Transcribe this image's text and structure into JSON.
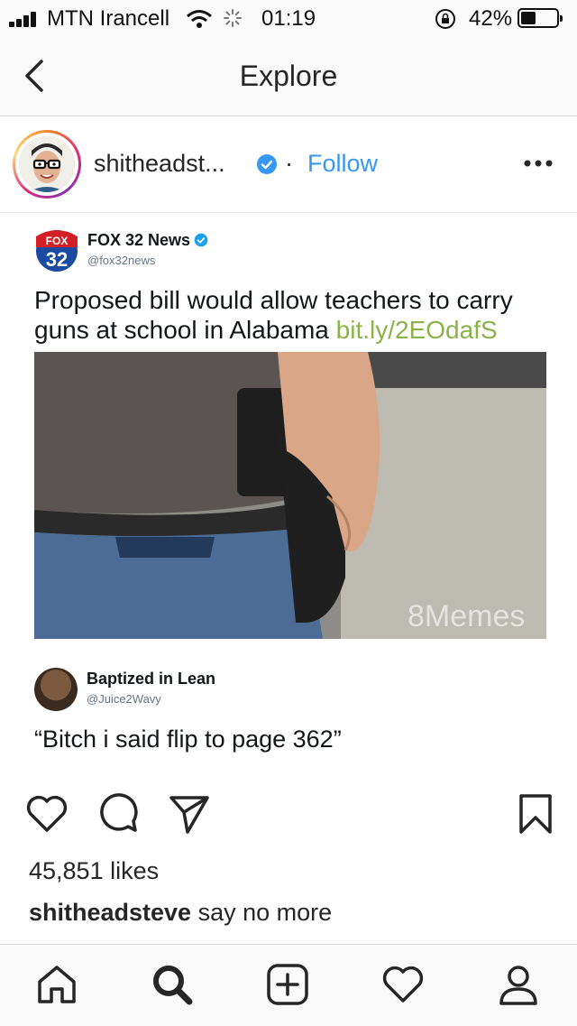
{
  "status_bar": {
    "carrier": "MTN Irancell",
    "time": "01:19",
    "battery": "42%",
    "battery_level": 0.42
  },
  "nav": {
    "title": "Explore"
  },
  "post": {
    "username": "shitheadst...",
    "follow_label": "Follow",
    "separator": "·",
    "image": {
      "tweet": {
        "logo_text": "FOX",
        "logo_number": "32",
        "name": "FOX 32 News",
        "handle": "@fox32news",
        "text": "Proposed bill would allow teachers to carry guns at school in Alabama",
        "link": "bit.ly/2EOdafS",
        "watermark": "8Memes"
      },
      "reply": {
        "name": "Baptized in Lean",
        "handle": "@Juice2Wavy",
        "text": "“Bitch i said flip to page 362”"
      }
    },
    "likes": "45,851 likes",
    "caption_user": "shitheadsteve",
    "caption_text": "say no more"
  },
  "colors": {
    "accent": "#3897f0",
    "link_green": "#8bb34a"
  },
  "icons": {
    "actions": [
      "heart-icon",
      "comment-icon",
      "share-icon",
      "bookmark-icon"
    ],
    "tabs": [
      "home-icon",
      "search-icon",
      "add-icon",
      "activity-icon",
      "profile-icon"
    ]
  }
}
